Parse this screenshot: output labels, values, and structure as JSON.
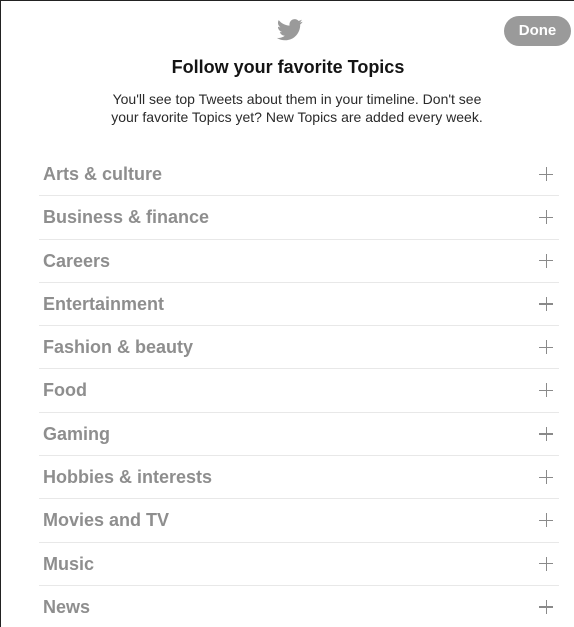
{
  "header": {
    "logo_icon": "twitter-bird-icon",
    "done_label": "Done"
  },
  "intro": {
    "title": "Follow your favorite Topics",
    "subtitle": "You'll see top Tweets about them in your timeline. Don't see your favorite Topics yet? New Topics are added every week."
  },
  "topics": [
    {
      "label": "Arts & culture",
      "icon": "plus-icon"
    },
    {
      "label": "Business & finance",
      "icon": "plus-icon"
    },
    {
      "label": "Careers",
      "icon": "plus-icon"
    },
    {
      "label": "Entertainment",
      "icon": "plus-icon"
    },
    {
      "label": "Fashion & beauty",
      "icon": "plus-icon"
    },
    {
      "label": "Food",
      "icon": "plus-icon"
    },
    {
      "label": "Gaming",
      "icon": "plus-icon"
    },
    {
      "label": "Hobbies & interests",
      "icon": "plus-icon"
    },
    {
      "label": "Movies and TV",
      "icon": "plus-icon"
    },
    {
      "label": "Music",
      "icon": "plus-icon"
    },
    {
      "label": "News",
      "icon": "plus-icon"
    }
  ],
  "colors": {
    "done_button_bg": "#9a9a9a",
    "topic_text": "#8e8e8e",
    "title_text": "#141414"
  }
}
